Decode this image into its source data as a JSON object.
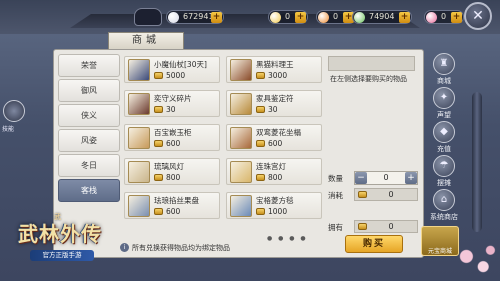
{
  "currency": {
    "items": [
      {
        "value": "6729418",
        "color": "#d6d9e6"
      },
      {
        "value": "0",
        "color": "#f2c94c"
      },
      {
        "value": "0",
        "color": "#ee8b32"
      },
      {
        "value": "74904",
        "color": "#69c05a"
      },
      {
        "value": "0",
        "color": "#e86a9a"
      }
    ],
    "plus": "+"
  },
  "shop_title": "商城",
  "tabs": [
    "荣誉",
    "御风",
    "侠义",
    "风姿",
    "冬日",
    "客栈"
  ],
  "active_tab": 5,
  "items": [
    {
      "name": "小魔仙杖[30天]",
      "price": "5000",
      "color": "#3b4a7a"
    },
    {
      "name": "黑猫料理王",
      "price": "3000",
      "color": "#8a4b2a"
    },
    {
      "name": "奕守义碎片",
      "price": "30",
      "color": "#6b3a2e"
    },
    {
      "name": "家具鉴定符",
      "price": "30",
      "color": "#b88a3a"
    },
    {
      "name": "百宝嵌玉柜",
      "price": "600",
      "color": "#c79a5a"
    },
    {
      "name": "双鸾菱花坐榻",
      "price": "600",
      "color": "#a8683a"
    },
    {
      "name": "琉璃风灯",
      "price": "800",
      "color": "#c9b48a"
    },
    {
      "name": "连珠宫灯",
      "price": "800",
      "color": "#d9b66a"
    },
    {
      "name": "珐琅掐丝果盘",
      "price": "600",
      "color": "#7a8fb0"
    },
    {
      "name": "宝格菱方毯",
      "price": "1000",
      "color": "#6a8ab8"
    }
  ],
  "pager_dots": "● ● ● ●",
  "notice": "所有兑换获得物品均为绑定物品",
  "notice_icon": "i",
  "detail": {
    "hint": "在左侧选择要购买的物品",
    "qty_label": "数量",
    "qty_value": "0",
    "minus": "−",
    "plus": "+",
    "cost_label": "消耗",
    "cost_value": "0",
    "own_label": "拥有",
    "own_value": "0",
    "buy_label": "购买"
  },
  "side_menu": [
    {
      "label": "商城",
      "icon": "shop-icon",
      "glyph": "♜"
    },
    {
      "label": "声望",
      "icon": "reputation-icon",
      "glyph": "✦"
    },
    {
      "label": "充值",
      "icon": "recharge-icon",
      "glyph": "◆"
    },
    {
      "label": "摆摊",
      "icon": "stall-icon",
      "glyph": "☂"
    },
    {
      "label": "系统商店",
      "icon": "system-shop-icon",
      "glyph": "⌂"
    }
  ],
  "vip_label": "元宝商城",
  "close_glyph": "✕",
  "left_avatar_label": "技能",
  "logo": {
    "top": "武",
    "title": "武林外传",
    "band": "官方正版手游"
  }
}
